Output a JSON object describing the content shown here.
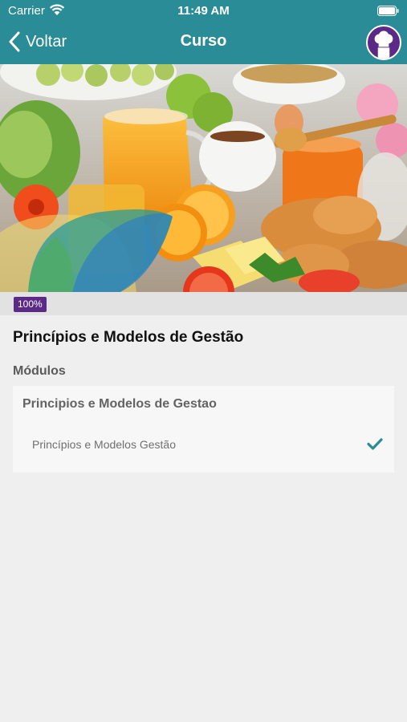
{
  "status_bar": {
    "carrier": "Carrier",
    "time": "11:49 AM"
  },
  "nav": {
    "back_label": "Voltar",
    "title": "Curso",
    "avatar_icon": "chef-hat-icon"
  },
  "course": {
    "progress": "100%",
    "progress_fraction": 1.0,
    "title": "Princípios e Modelos de Gestão"
  },
  "modules": {
    "heading": "Módulos",
    "items": [
      {
        "title": "Principios e Modelos de Gestao",
        "lessons": [
          {
            "label": "Princípios e Modelos Gestão",
            "completed": true
          }
        ]
      }
    ]
  },
  "colors": {
    "header": "#2a8c96",
    "badge": "#5b2a86",
    "check": "#2a8c96"
  }
}
